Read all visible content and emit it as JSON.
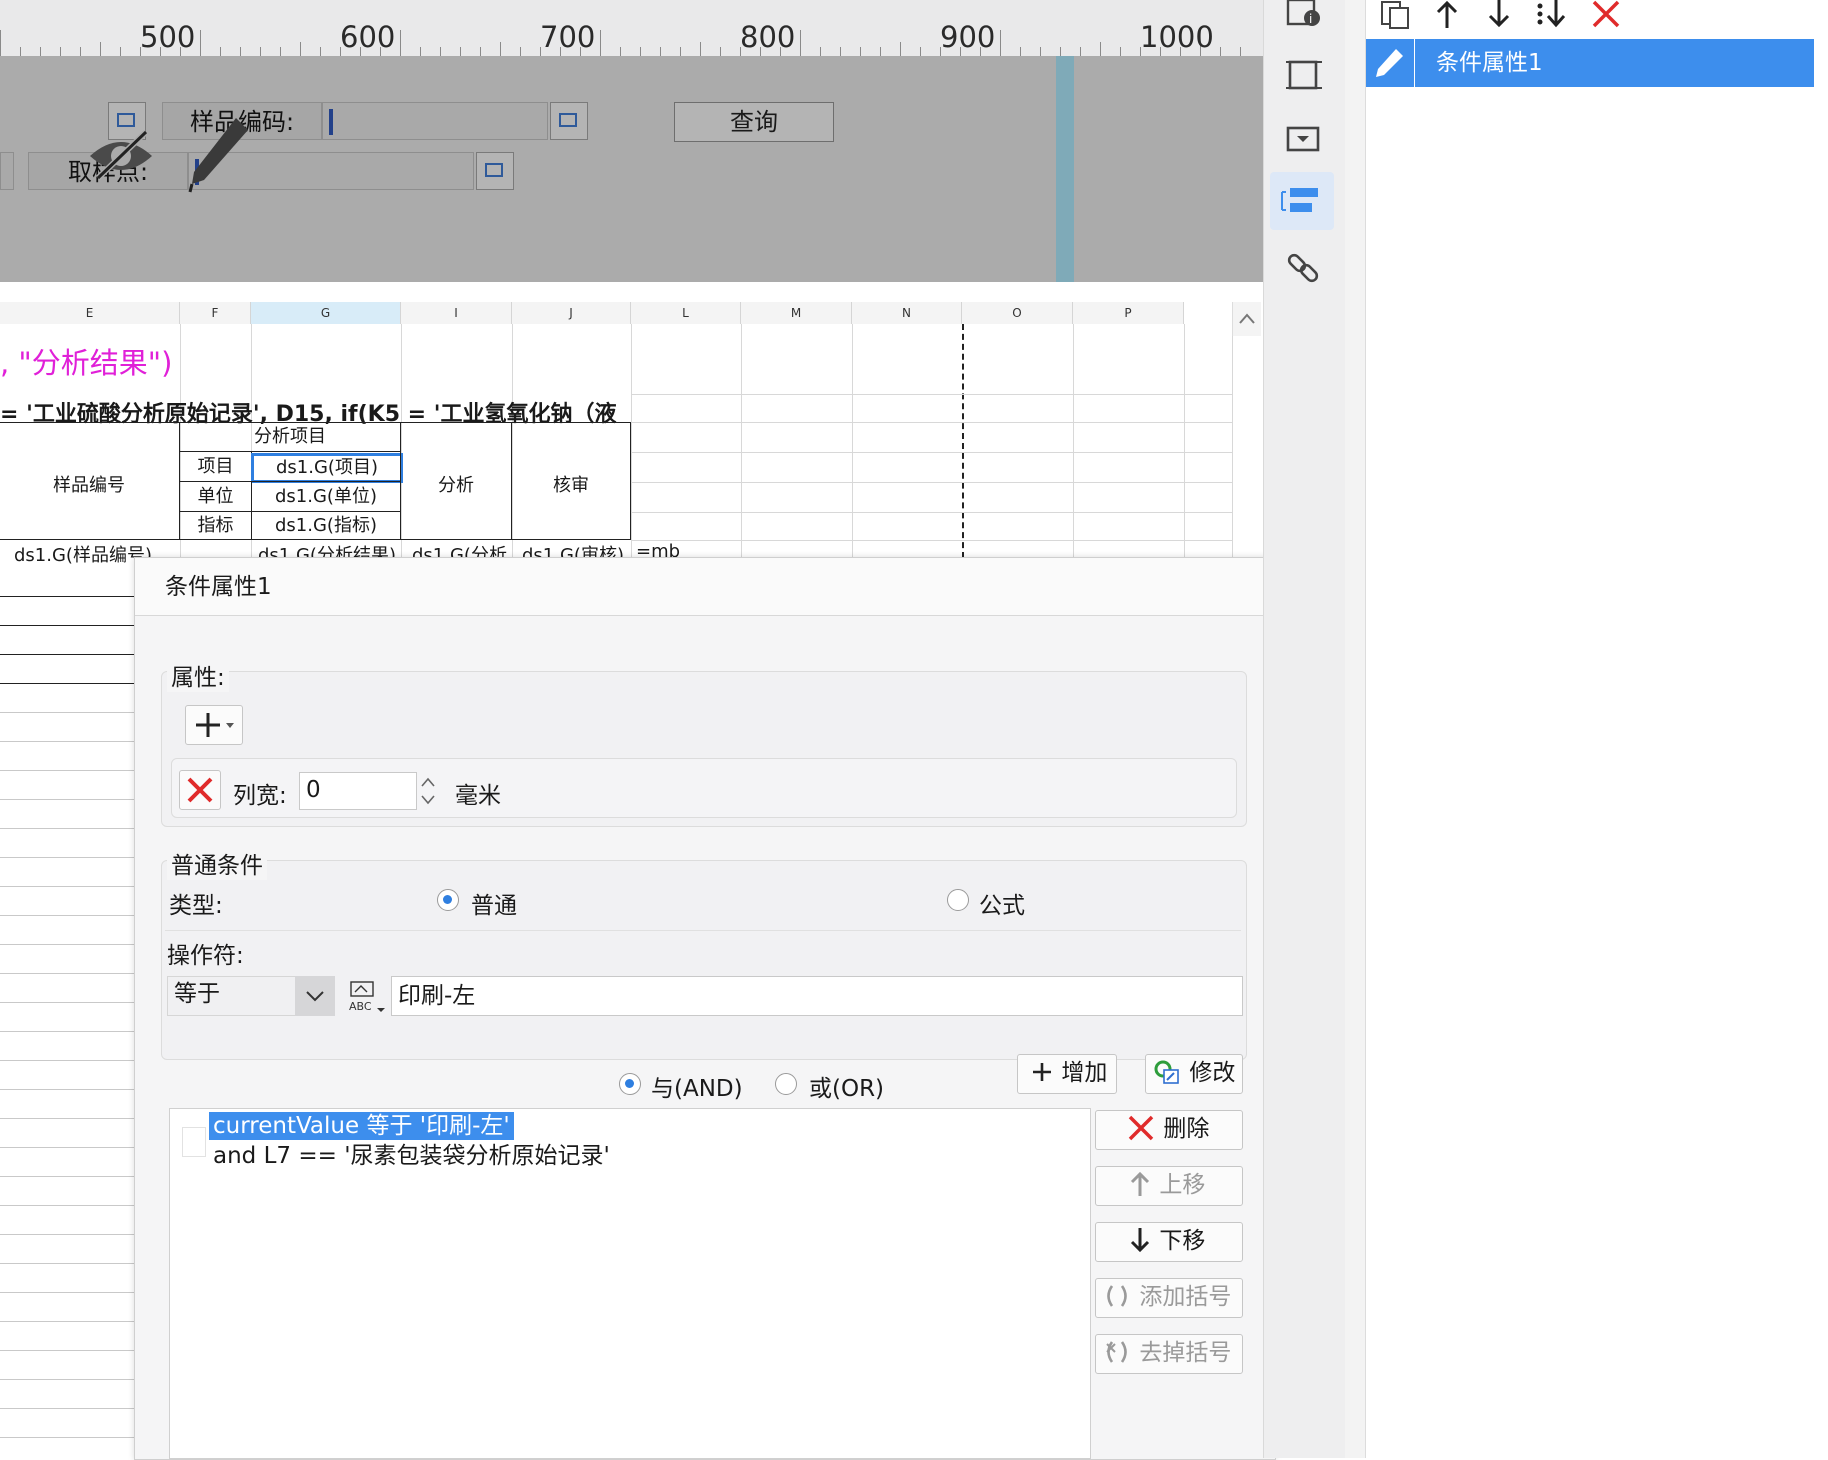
{
  "ruler": {
    "labels": [
      "500",
      "600",
      "700",
      "800",
      "900",
      "1000"
    ]
  },
  "param_panel": {
    "sample_code_label": "样品编码:",
    "sample_point_label": "取样点:",
    "query_button": "查询"
  },
  "sheet": {
    "columns": [
      "E",
      "F",
      "G",
      "I",
      "J",
      "L",
      "M",
      "N",
      "O",
      "P"
    ],
    "row1_text": ", \"分析结果\")",
    "row2_text": "= '工业硫酸分析原始记录', D15, if(K5 = '工业氢氧化钠（液",
    "header": {
      "sample_no": "样品编号",
      "analysis_items": "分析项目",
      "item": "项目",
      "unit": "单位",
      "index": "指标",
      "analysis": "分析",
      "review": "核审",
      "g_item": "ds1.G(项目)",
      "g_unit": "ds1.G(单位)",
      "g_index": "ds1.G(指标)"
    },
    "data_row": {
      "sample": "ds1.G(样品编号)",
      "result": "ds1.G(分析结果)",
      "analysis": "ds1.G(分析",
      "review": "ds1.G(审核)",
      "formula": "=mb"
    }
  },
  "dialog": {
    "title": "条件属性1",
    "attributes": {
      "title": "属性:",
      "column_width_label": "列宽:",
      "column_width_value": "0",
      "unit": "毫米"
    },
    "condition": {
      "title": "普通条件",
      "type_label": "类型:",
      "type_normal": "普通",
      "type_formula": "公式",
      "operator_label": "操作符:",
      "operator_value": "等于",
      "value": "印刷-左",
      "and_label": "与(AND)",
      "or_label": "或(OR)",
      "add_button": "增加",
      "modify_button": "修改",
      "conditions": [
        "currentValue 等于 '印刷-左'",
        "and L7 == '尿素包装袋分析原始记录'"
      ],
      "buttons": {
        "delete": "删除",
        "move_up": "上移",
        "move_down": "下移",
        "add_bracket": "添加括号",
        "remove_bracket": "去掉括号"
      }
    }
  },
  "right_panel": {
    "items": [
      "条件属性1"
    ]
  },
  "colors": {
    "accent": "#3d8eed",
    "delete_red": "#e02b2b",
    "magenta": "#e020d8"
  }
}
